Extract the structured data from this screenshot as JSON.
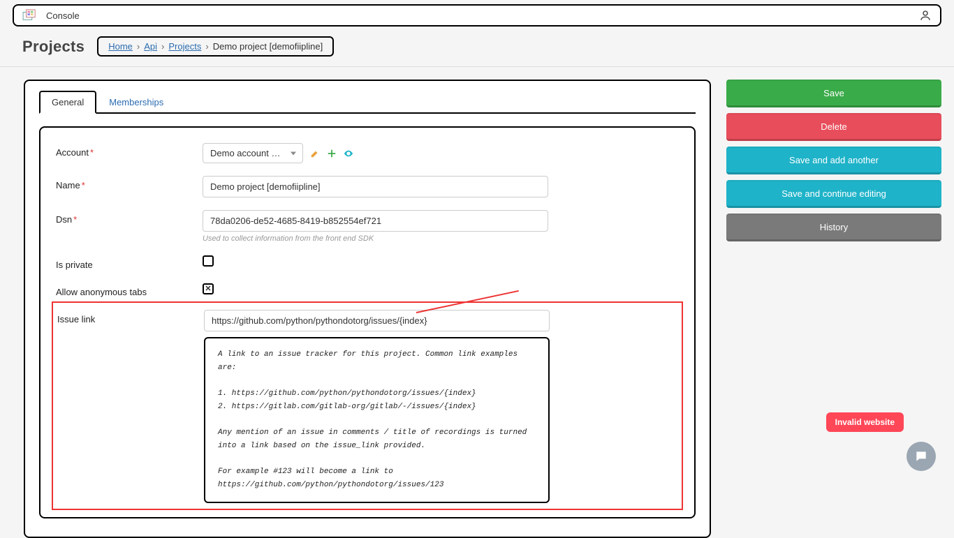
{
  "header": {
    "title": "Console"
  },
  "page_title": "Projects",
  "breadcrumb": {
    "home": "Home",
    "api": "Api",
    "projects": "Projects",
    "current": "Demo project [demofiipline]"
  },
  "tabs": {
    "general": "General",
    "memberships": "Memberships"
  },
  "form": {
    "account_label": "Account",
    "account_value": "Demo account [demofii…",
    "name_label": "Name",
    "name_value": "Demo project [demofiipline]",
    "dsn_label": "Dsn",
    "dsn_value": "78da0206-de52-4685-8419-b852554ef721",
    "dsn_help": "Used to collect information from the front end SDK",
    "is_private_label": "Is private",
    "is_private_checked": false,
    "allow_anon_label": "Allow anonymous tabs",
    "allow_anon_checked": true,
    "issue_link_label": "Issue link",
    "issue_link_value": "https://github.com/python/pythondotorg/issues/{index}",
    "issue_link_help": "A link to an issue tracker for this project. Common link examples are:\n\n1. https://github.com/python/pythondotorg/issues/{index}\n2. https://gitlab.com/gitlab-org/gitlab/-/issues/{index}\n\nAny mention of an issue in comments / title of recordings is turned\ninto a link based on the issue_link provided.\n\nFor example #123 will become a link to\nhttps://github.com/python/pythondotorg/issues/123"
  },
  "buttons": {
    "save": "Save",
    "delete": "Delete",
    "save_add": "Save and add another",
    "save_continue": "Save and continue editing",
    "history": "History"
  },
  "badge": "Invalid website"
}
